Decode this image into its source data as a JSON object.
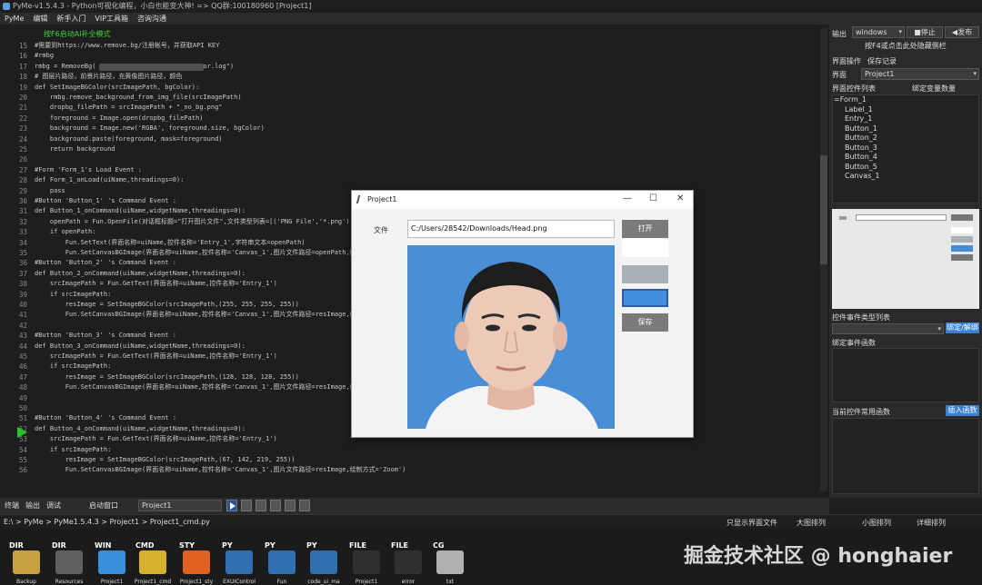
{
  "window": {
    "title": "PyMe-v1.5.4.3 - Python可视化编程，小白也能变大神! => QQ群:100180960   [Project1]"
  },
  "menu": [
    "PyMe",
    "编辑",
    "新手入门",
    "VIP工具箱",
    "咨询沟通"
  ],
  "editor": {
    "hint": "按F6启动AI补全模式",
    "line_numbers": [
      "15",
      "16",
      "17",
      "18",
      "19",
      "20",
      "21",
      "22",
      "23",
      "24",
      "25",
      "26",
      "27",
      "28",
      "29",
      "30",
      "31",
      "32",
      "33",
      "34",
      "35",
      "36",
      "37",
      "38",
      "39",
      "40",
      "41",
      "42",
      "43",
      "44",
      "45",
      "46",
      "47",
      "48",
      "49",
      "50",
      "51",
      "52",
      "53",
      "54",
      "55",
      "56"
    ],
    "lines": [
      "#需要到https://www.remove.bg/注册帐号，并获取API KEY",
      "#rmbg",
      "rmbg = RemoveBg(                        \"error.log\")",
      "# 图层片路径，前景片路径，充黄像图片路径，颜色",
      "def SetImageBGColor(srcImagePath, bgColor):",
      "    rmbg.remove_background_from_img_file(srcImagePath)",
      "    dropbg_filePath = srcImagePath + \"_no_bg.png\"",
      "    foreground = Image.open(dropbg_filePath)",
      "    background = Image.new('RGBA', foreground.size, bgColor)",
      "    background.paste(foreground, mask=foreground)",
      "    return background",
      "",
      "#Form 'Form_1's Load Event :",
      "def Form_1_onLoad(uiName,threadings=0):",
      "    pass",
      "#Button 'Button_1' 's Command Event :",
      "def Button_1_onCommand(uiName,widgetName,threadings=0):",
      "    openPath = Fun.OpenFile(对话框标题=\"打开图片文件\",文件类型列表=[('PNG File','*.png'),",
      "    if openPath:",
      "        Fun.SetText(界面名称=uiName,控件名称='Entry_1',字符串文本=openPath)",
      "        Fun.SetCanvasBGImage(界面名称=uiName,控件名称='Canvas_1',图片文件路径=openPath,绘",
      "#Button 'Button_2' 's Command Event :",
      "def Button_2_onCommand(uiName,widgetName,threadings=0):",
      "    srcImagePath = Fun.GetText(界面名称=uiName,控件名称='Entry_1')",
      "    if srcImagePath:",
      "        resImage = SetImageBGColor(srcImagePath,(255, 255, 255, 255))",
      "        Fun.SetCanvasBGImage(界面名称=uiName,控件名称='Canvas_1',图片文件路径=resImage,绘",
      "",
      "#Button 'Button_3' 's Command Event :",
      "def Button_3_onCommand(uiName,widgetName,threadings=0):",
      "    srcImagePath = Fun.GetText(界面名称=uiName,控件名称='Entry_1')",
      "    if srcImagePath:",
      "        resImage = SetImageBGColor(srcImagePath,(128, 128, 128, 255))",
      "        Fun.SetCanvasBGImage(界面名称=uiName,控件名称='Canvas_1',图片文件路径=resImage,绘",
      "",
      "",
      "#Button 'Button_4' 's Command Event :",
      "def Button_4_onCommand(uiName,widgetName,threadings=0):",
      "    srcImagePath = Fun.GetText(界面名称=uiName,控件名称='Entry_1')",
      "    if srcImagePath:",
      "        resImage = SetImageBGColor(srcImagePath,(67, 142, 219, 255))",
      "        Fun.SetCanvasBGImage(界面名称=uiName,控件名称='Canvas_1',图片文件路径=resImage,绘制方式='Zoom')"
    ]
  },
  "right_panel": {
    "output_label": "输出",
    "platform": "windows",
    "stop_label": "■停止",
    "publish_label": "◀发布",
    "hint": "按F4或点击此处隐藏侧栏",
    "tabs": [
      "界面操作",
      "保存记录"
    ],
    "ui_label": "界面",
    "ui_value": "Project1",
    "controls_label": "界面控件列表",
    "bind_var_label": "绑定变量数量",
    "tree": [
      "=Form_1",
      "Label_1",
      "Entry_1",
      "Button_1",
      "Button_2",
      "Button_3",
      "Button_4",
      "Button_5",
      "Canvas_1"
    ],
    "event_type_label": "控件事件类型列表",
    "bind_label": "绑定/解绑",
    "bound_func_label": "绑定事件函数",
    "common_func_label": "当前控件常用函数",
    "insert_func_label": "插入函数"
  },
  "bottom": {
    "tabs": [
      "终端",
      "输出",
      "调试"
    ],
    "launch_label": "启动窗口",
    "launch_value": "Project1"
  },
  "path": {
    "text": "E:\\ > PyMe > PyMe1.5.4.3 > Project1 > Project1_cmd.py",
    "view_modes": [
      "只显示界面文件",
      "大图排列",
      "小图排列",
      "详细排列"
    ]
  },
  "files": [
    {
      "tag": "DIR",
      "name": "Backup",
      "color": "#c8a040"
    },
    {
      "tag": "DIR",
      "name": "Resources",
      "color": "#606060"
    },
    {
      "tag": "WIN",
      "name": "Project1",
      "color": "#3a90d8"
    },
    {
      "tag": "CMD",
      "name": "Project1_cmd",
      "color": "#d8b030"
    },
    {
      "tag": "STY",
      "name": "Project1_sty",
      "color": "#e06020"
    },
    {
      "tag": "PY",
      "name": "EXUIControl",
      "color": "#3070b0"
    },
    {
      "tag": "PY",
      "name": "Fun",
      "color": "#3070b0"
    },
    {
      "tag": "PY",
      "name": "code_ui_ma",
      "color": "#3070b0"
    },
    {
      "tag": "FILE",
      "name": "Project1",
      "color": "#303030"
    },
    {
      "tag": "FILE",
      "name": "error",
      "color": "#303030"
    },
    {
      "tag": "CG",
      "name": "txt",
      "color": "#b0b0b0"
    }
  ],
  "watermark": "掘金技术社区 @ honghaier",
  "dialog": {
    "title": "Project1",
    "file_label": "文件",
    "file_path": "C:/Users/28542/Downloads/Head.png",
    "open_label": "打开",
    "save_label": "保存",
    "swatches": [
      "#ffffff",
      "#aab0b8",
      "#438edb"
    ]
  }
}
